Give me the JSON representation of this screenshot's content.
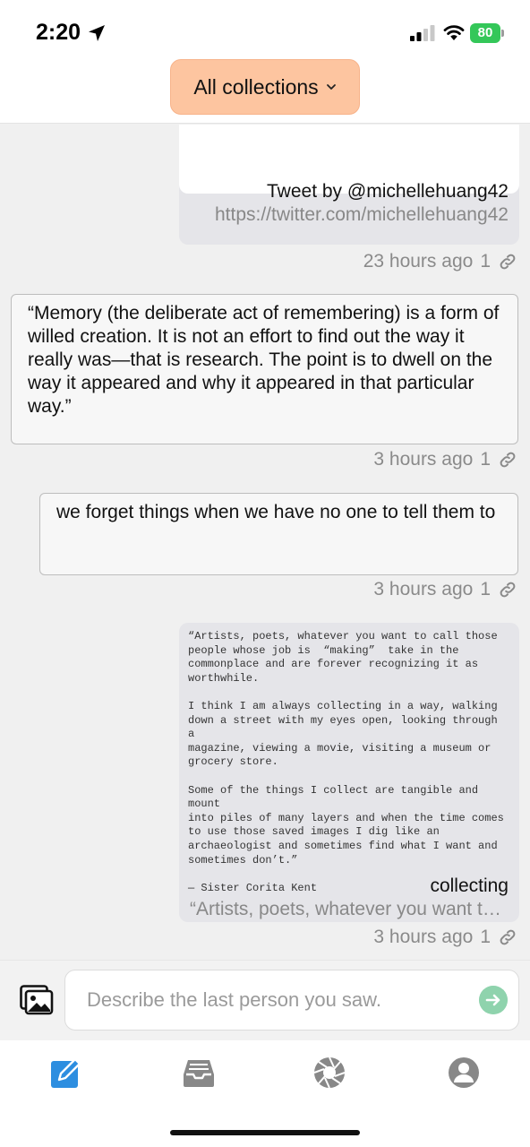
{
  "status_bar": {
    "time": "2:20",
    "battery": "80"
  },
  "header": {
    "collections_label": "All collections"
  },
  "feed": {
    "items": [
      {
        "type": "link",
        "title": "Tweet by @michellehuang42",
        "url": "https://twitter.com/michellehuang42",
        "time": "23 hours ago",
        "link_count": "1"
      },
      {
        "type": "text",
        "text": "“Memory (the deliberate act of remembering) is a form of willed creation. It is not an effort to find out the way it really was—that is research. The point is to dwell on the way it appeared and why it appeared in that particular way.”",
        "time": "3 hours ago",
        "link_count": "1"
      },
      {
        "type": "text",
        "text": "we forget things when we have no one to tell them to",
        "time": "3 hours ago",
        "link_count": "1"
      },
      {
        "type": "note",
        "note_text": "“Artists, poets, whatever you want to call those\npeople whose job is  “making”  take in the\ncommonplace and are forever recognizing it as\nworthwhile.\n\nI think I am always collecting in a way, walking\ndown a street with my eyes open, looking through a\nmagazine, viewing a movie, visiting a museum or\ngrocery store.\n\nSome of the things I collect are tangible and mount\ninto piles of many layers and when the time comes\nto use those saved images I dig like an\narchaeologist and sometimes find what I want and\nsometimes don’t.”\n\n— Sister Corita Kent",
        "title": "collecting",
        "preview": "“Artists, poets, whatever you want to call those",
        "time": "3 hours ago",
        "link_count": "1"
      }
    ]
  },
  "composer": {
    "placeholder": "Describe the last person you saw."
  },
  "tabs": [
    {
      "icon": "compose-icon",
      "active": true
    },
    {
      "icon": "inbox-icon",
      "active": false
    },
    {
      "icon": "aperture-icon",
      "active": false
    },
    {
      "icon": "profile-icon",
      "active": false
    }
  ],
  "colors": {
    "accent": "#2d8ee0",
    "collections_button": "#fdc5a0",
    "send_button": "#8fd3ad",
    "battery": "#34c759"
  }
}
